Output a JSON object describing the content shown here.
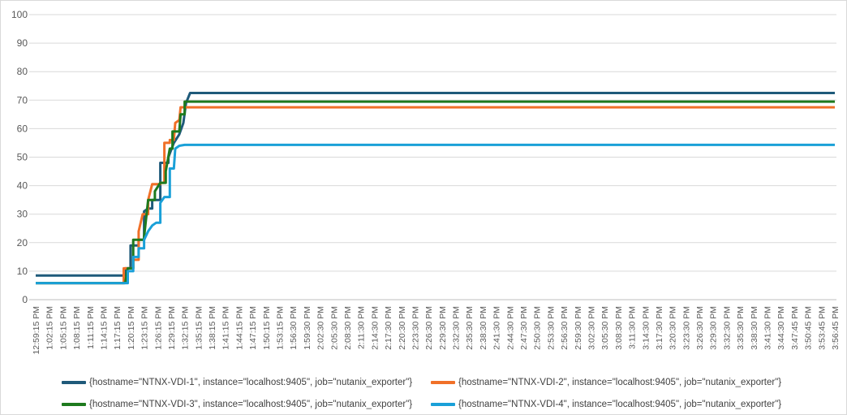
{
  "chart_data": {
    "type": "line",
    "title": "",
    "xlabel": "",
    "ylabel": "",
    "ylim": [
      0,
      100
    ],
    "yticks": [
      "0",
      "10",
      "20",
      "30",
      "40",
      "50",
      "60",
      "70",
      "80",
      "90",
      "100"
    ],
    "grid": true,
    "legend_position": "bottom",
    "categories": [
      "12:59:15 PM",
      "1:02:15 PM",
      "1:05:15 PM",
      "1:08:15 PM",
      "1:11:15 PM",
      "1:14:15 PM",
      "1:17:15 PM",
      "1:20:15 PM",
      "1:23:15 PM",
      "1:26:15 PM",
      "1:29:15 PM",
      "1:32:15 PM",
      "1:35:15 PM",
      "1:38:15 PM",
      "1:41:15 PM",
      "1:44:15 PM",
      "1:47:15 PM",
      "1:50:15 PM",
      "1:53:15 PM",
      "1:56:30 PM",
      "1:59:30 PM",
      "2:02:30 PM",
      "2:05:30 PM",
      "2:08:30 PM",
      "2:11:30 PM",
      "2:14:30 PM",
      "2:17:30 PM",
      "2:20:30 PM",
      "2:23:30 PM",
      "2:26:30 PM",
      "2:29:30 PM",
      "2:32:30 PM",
      "2:35:30 PM",
      "2:38:30 PM",
      "2:41:30 PM",
      "2:44:30 PM",
      "2:47:30 PM",
      "2:50:30 PM",
      "2:53:30 PM",
      "2:56:30 PM",
      "2:59:30 PM",
      "3:02:30 PM",
      "3:05:30 PM",
      "3:08:30 PM",
      "3:11:30 PM",
      "3:14:30 PM",
      "3:17:30 PM",
      "3:20:30 PM",
      "3:23:30 PM",
      "3:26:30 PM",
      "3:29:30 PM",
      "3:32:30 PM",
      "3:35:30 PM",
      "3:38:30 PM",
      "3:41:30 PM",
      "3:44:30 PM",
      "3:47:45 PM",
      "3:50:45 PM",
      "3:53:45 PM",
      "3:56:45 PM"
    ],
    "series": [
      {
        "name": "{hostname=\"NTNX-VDI-1\", instance=\"localhost:9405\", job=\"nutanix_exporter\"}",
        "color": "#1f5a7a",
        "points": [
          [
            0,
            8.5
          ],
          [
            6.6,
            8.5
          ],
          [
            6.6,
            11
          ],
          [
            7.0,
            11
          ],
          [
            7.0,
            19
          ],
          [
            7.6,
            19
          ],
          [
            7.6,
            21
          ],
          [
            8.0,
            21
          ],
          [
            8.0,
            31
          ],
          [
            8.3,
            32
          ],
          [
            8.6,
            32
          ],
          [
            8.6,
            35
          ],
          [
            9.2,
            35
          ],
          [
            9.2,
            48
          ],
          [
            9.8,
            48
          ],
          [
            9.8,
            50
          ],
          [
            10.2,
            55
          ],
          [
            10.6,
            58
          ],
          [
            10.9,
            62
          ],
          [
            11.1,
            69
          ],
          [
            11.4,
            72.5
          ],
          [
            59,
            72.5
          ]
        ]
      },
      {
        "name": "{hostname=\"NTNX-VDI-2\", instance=\"localhost:9405\", job=\"nutanix_exporter\"}",
        "color": "#f07028",
        "points": [
          [
            0,
            5.8
          ],
          [
            6.5,
            5.8
          ],
          [
            6.5,
            11
          ],
          [
            7.2,
            11
          ],
          [
            7.2,
            14
          ],
          [
            7.6,
            14
          ],
          [
            7.6,
            24
          ],
          [
            7.9,
            30
          ],
          [
            8.3,
            30
          ],
          [
            8.3,
            35
          ],
          [
            8.6,
            40.5
          ],
          [
            9.2,
            40.5
          ],
          [
            9.2,
            41
          ],
          [
            9.5,
            41
          ],
          [
            9.5,
            55
          ],
          [
            9.9,
            55
          ],
          [
            9.9,
            56
          ],
          [
            10.2,
            56
          ],
          [
            10.3,
            62
          ],
          [
            10.6,
            63
          ],
          [
            10.7,
            67.5
          ],
          [
            59,
            67.5
          ]
        ]
      },
      {
        "name": "{hostname=\"NTNX-VDI-3\", instance=\"localhost:9405\", job=\"nutanix_exporter\"}",
        "color": "#1e7a1e",
        "points": [
          [
            0,
            5.8
          ],
          [
            6.6,
            5.8
          ],
          [
            6.8,
            11
          ],
          [
            7.2,
            11
          ],
          [
            7.2,
            21
          ],
          [
            8.0,
            21
          ],
          [
            8.0,
            22
          ],
          [
            8.3,
            35
          ],
          [
            8.8,
            35
          ],
          [
            8.8,
            38
          ],
          [
            9.2,
            41
          ],
          [
            9.6,
            41
          ],
          [
            9.6,
            45
          ],
          [
            9.9,
            53
          ],
          [
            10.1,
            53
          ],
          [
            10.1,
            59
          ],
          [
            10.6,
            59
          ],
          [
            10.7,
            65
          ],
          [
            11.0,
            65
          ],
          [
            11.0,
            69.5
          ],
          [
            59,
            69.5
          ]
        ]
      },
      {
        "name": "{hostname=\"NTNX-VDI-4\", instance=\"localhost:9405\", job=\"nutanix_exporter\"}",
        "color": "#1aa0d8",
        "points": [
          [
            0,
            5.8
          ],
          [
            6.8,
            5.8
          ],
          [
            6.8,
            10
          ],
          [
            7.2,
            10
          ],
          [
            7.2,
            15
          ],
          [
            7.6,
            15
          ],
          [
            7.6,
            18
          ],
          [
            8.0,
            18
          ],
          [
            8.0,
            21
          ],
          [
            8.3,
            24
          ],
          [
            8.6,
            26
          ],
          [
            8.9,
            27
          ],
          [
            9.2,
            27
          ],
          [
            9.2,
            34
          ],
          [
            9.5,
            36
          ],
          [
            9.9,
            36
          ],
          [
            9.9,
            46
          ],
          [
            10.2,
            46
          ],
          [
            10.3,
            53
          ],
          [
            10.6,
            54
          ],
          [
            11.0,
            54.3
          ],
          [
            59,
            54.3
          ]
        ]
      }
    ]
  }
}
